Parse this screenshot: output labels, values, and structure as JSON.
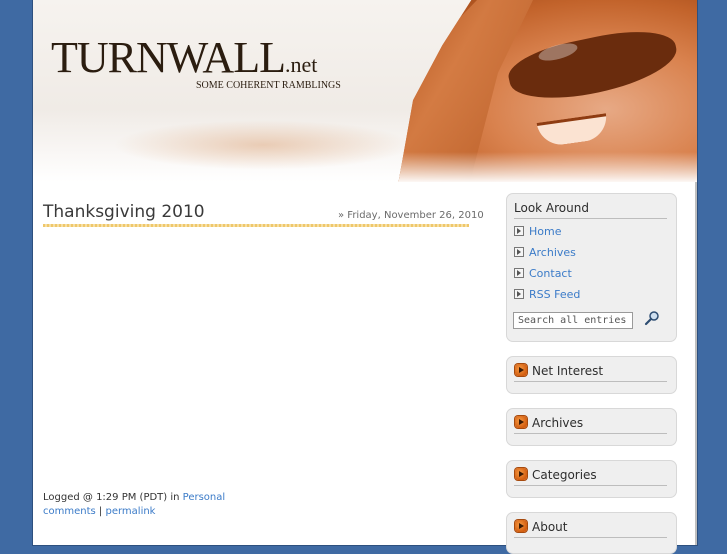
{
  "site": {
    "logo_main": "TURNWALL",
    "logo_suffix": ".net",
    "tagline": "SOME COHERENT RAMBLINGS"
  },
  "post": {
    "title": "Thanksgiving 2010",
    "date": "» Friday, November 26, 2010",
    "logged_prefix": "Logged @ 1:29 PM (PDT) in ",
    "category": "Personal",
    "comments_label": "comments",
    "separator": "|",
    "permalink_label": "permalink"
  },
  "sidebar": {
    "look_around": {
      "title": "Look Around",
      "items": [
        {
          "label": "Home"
        },
        {
          "label": "Archives"
        },
        {
          "label": "Contact"
        },
        {
          "label": "RSS Feed"
        }
      ]
    },
    "search": {
      "placeholder": "Search all entries"
    },
    "boxes": [
      {
        "title": "Net Interest"
      },
      {
        "title": "Archives"
      },
      {
        "title": "Categories"
      },
      {
        "title": "About"
      }
    ]
  },
  "colors": {
    "background": "#3f6aa3",
    "link": "#3b7bc8",
    "accent": "#d35f12",
    "title_rule": "#efc76a"
  }
}
